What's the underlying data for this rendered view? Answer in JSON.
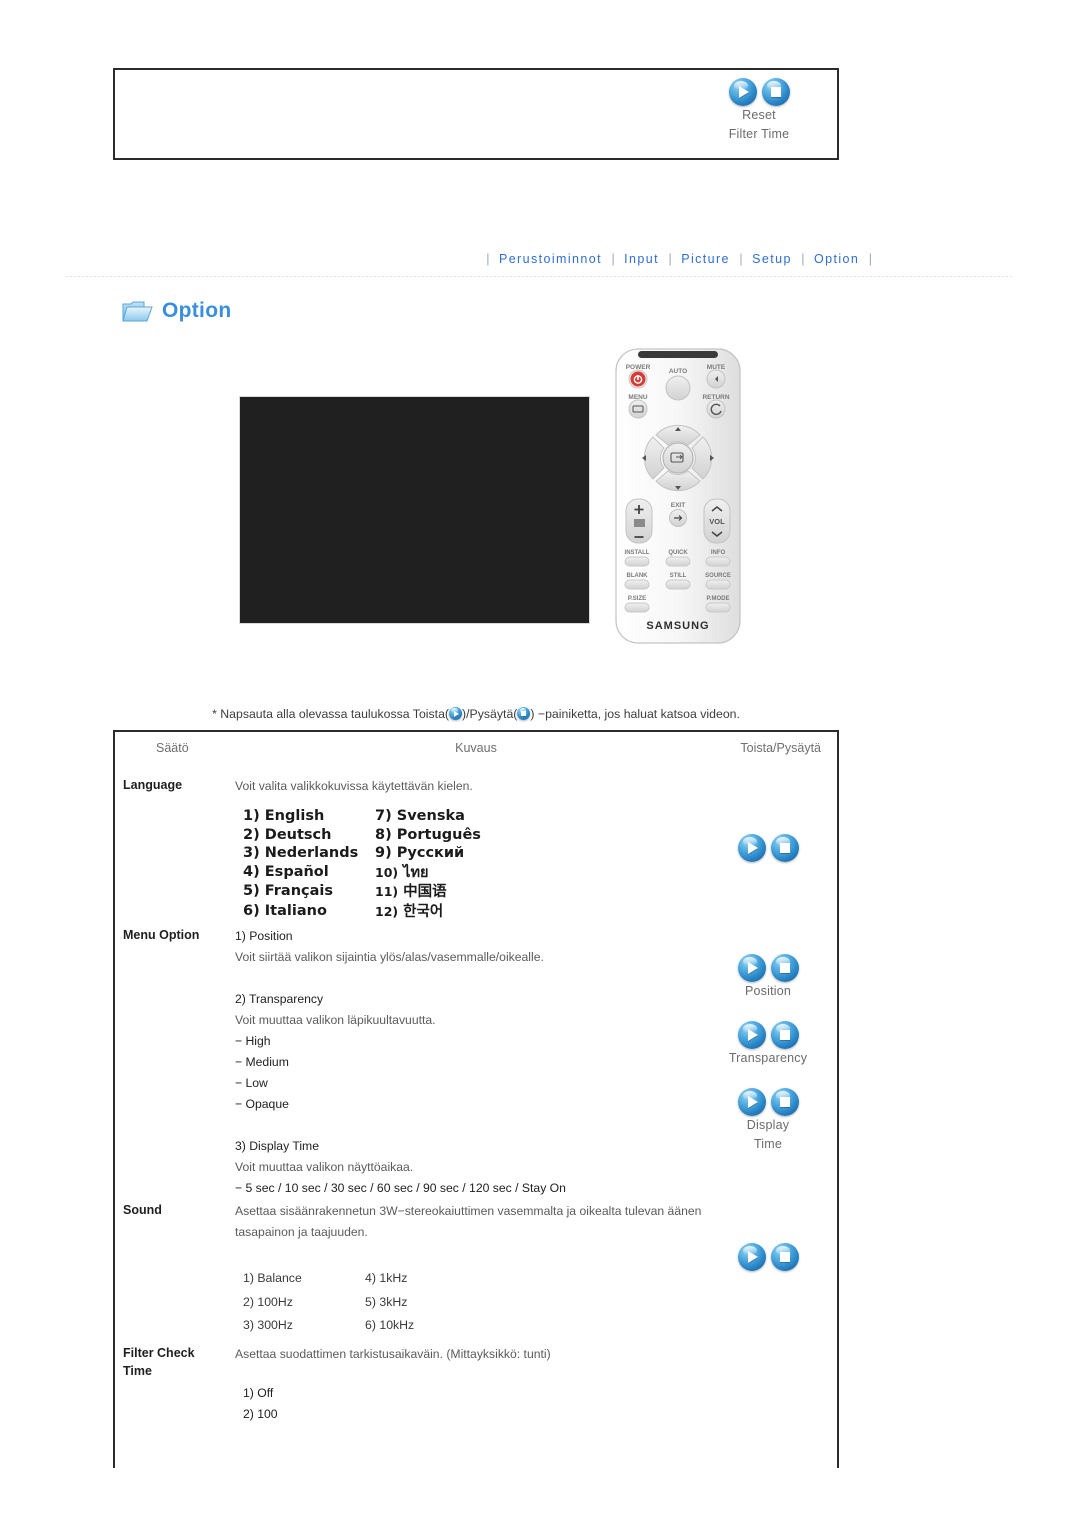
{
  "top_box": {
    "play_label": "play-button",
    "stop_label": "stop-button",
    "caption_line1": "Reset",
    "caption_line2": "Filter Time"
  },
  "nav": {
    "separator": "|",
    "items": [
      {
        "label": "Perustoiminnot"
      },
      {
        "label": "Input"
      },
      {
        "label": "Picture"
      },
      {
        "label": "Setup"
      },
      {
        "label": "Option"
      }
    ]
  },
  "page": {
    "title": "Option",
    "folder_icon": "folder-icon",
    "accent_color": "#3a8ede",
    "nav_link_color": "#2f6fd0"
  },
  "media": {
    "screen_placeholder": "projector-osd-screen",
    "remote": {
      "brand": "SAMSUNG",
      "buttons": [
        "POWER",
        "AUTO",
        "MUTE",
        "MENU",
        "RETURN",
        "EXIT",
        "VOL",
        "INSTALL",
        "QUICK",
        "INFO",
        "BLANK",
        "STILL",
        "SOURCE",
        "P.SIZE",
        "P.MODE"
      ]
    }
  },
  "note": {
    "prefix": "* Napsauta alla olevassa taulukossa Toista(",
    "middle": ")/Pysäytä(",
    "suffix": ") −painiketta, jos haluat katsoa videon."
  },
  "table": {
    "headers": {
      "setting": "Säätö",
      "description": "Kuvaus",
      "playstop": "Toista/Pysäytä"
    },
    "rows": [
      {
        "label": "Language",
        "desc": "Voit valita valikkokuvissa käytettävän kielen.",
        "languages": [
          {
            "num": "1)",
            "name": "English"
          },
          {
            "num": "7)",
            "name": "Svenska"
          },
          {
            "num": "2)",
            "name": "Deutsch"
          },
          {
            "num": "8)",
            "name": "Português"
          },
          {
            "num": "3)",
            "name": "Nederlands"
          },
          {
            "num": "9)",
            "name": "Русский"
          },
          {
            "num": "4)",
            "name": "Español"
          },
          {
            "num": "10)",
            "name": "ไทย"
          },
          {
            "num": "5)",
            "name": "Français"
          },
          {
            "num": "11)",
            "name": "中国语"
          },
          {
            "num": "6)",
            "name": "Italiano"
          },
          {
            "num": "12)",
            "name": "한국어"
          }
        ]
      },
      {
        "label": "Menu Option",
        "sub1_title": "1) Position",
        "sub1_desc": "Voit siirtää valikon sijaintia ylös/alas/vasemmalle/oikealle.",
        "sub2_title": "2) Transparency",
        "sub2_desc": "Voit muuttaa valikon läpikuultavuutta.",
        "sub2_opt1": "− High",
        "sub2_opt2": "− Medium",
        "sub2_opt3": "− Low",
        "sub2_opt4": "− Opaque",
        "sub3_title": "3) Display Time",
        "sub3_desc": "Voit muuttaa valikon näyttöaikaa.",
        "sub3_opts": "− 5 sec / 10 sec / 30 sec / 60 sec / 90 sec / 120 sec / Stay On",
        "play_label_1": "Position",
        "play_label_2": "Transparency",
        "play_label_3a": "Display",
        "play_label_3b": "Time"
      },
      {
        "label": "Sound",
        "desc_line1": "Asettaa sisäänrakennetun 3W−stereokaiuttimen vasemmalta ja oikealta tulevan äänen",
        "desc_line2": "tasapainon ja taajuuden.",
        "items": [
          "1) Balance",
          "4) 1kHz",
          "2) 100Hz",
          "5) 3kHz",
          "3) 300Hz",
          "6) 10kHz"
        ]
      },
      {
        "label_line1": "Filter Check",
        "label_line2": "Time",
        "desc": "Asettaa suodattimen tarkistusaikaväin. (Mittayksikkö: tunti)",
        "opt1": "1) Off",
        "opt2": "2) 100"
      }
    ]
  }
}
